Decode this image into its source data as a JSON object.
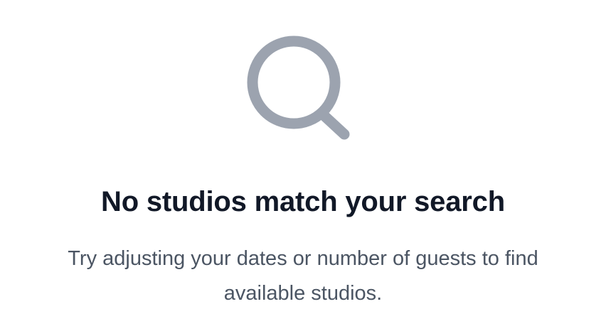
{
  "empty_state": {
    "icon": "search-icon",
    "icon_color": "#9ca3af",
    "title": "No studios match your search",
    "message": "Try adjusting your dates or number of guests to find available studios."
  }
}
